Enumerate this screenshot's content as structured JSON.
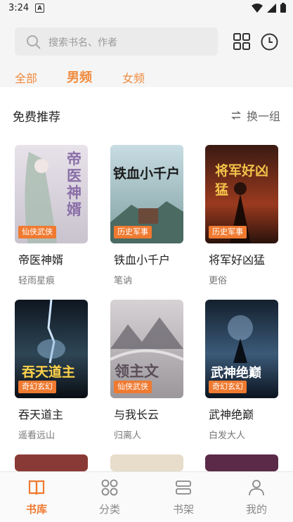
{
  "status_bar": {
    "time": "3:24",
    "notif_letter": "A"
  },
  "search": {
    "placeholder": "搜索书名、作者"
  },
  "tabs": [
    {
      "label": "全部",
      "active": false
    },
    {
      "label": "男频",
      "active": true
    },
    {
      "label": "女频",
      "active": false
    }
  ],
  "section": {
    "title": "免费推荐",
    "refresh_label": "换一组"
  },
  "books": [
    {
      "name": "帝医神婿",
      "author": "轻雨星痕",
      "tag": "仙侠武侠",
      "cover_text": "帝医神婿",
      "cover_color": "#d9d3dc"
    },
    {
      "name": "铁血小千户",
      "author": "笔讷",
      "tag": "历史军事",
      "cover_text": "铁血小千户",
      "cover_color": "#8fb0bd"
    },
    {
      "name": "将军好凶猛",
      "author": "更俗",
      "tag": "历史军事",
      "cover_text": "将军好凶猛",
      "cover_color": "#6a2a1a"
    },
    {
      "name": "吞天道主",
      "author": "遥看远山",
      "tag": "奇幻玄幻",
      "cover_text": "吞天道主",
      "cover_color": "#1f2b36"
    },
    {
      "name": "与我长云",
      "author": "归离人",
      "tag": "仙侠武侠",
      "cover_text": "领主文",
      "cover_color": "#a6a0a4"
    },
    {
      "name": "武神绝巅",
      "author": "白发大人",
      "tag": "奇幻玄幻",
      "cover_text": "武神绝巅",
      "cover_color": "#24364a"
    }
  ],
  "bottom_nav": [
    {
      "label": "书库",
      "icon": "book-icon",
      "active": true
    },
    {
      "label": "分类",
      "icon": "category-icon",
      "active": false
    },
    {
      "label": "书架",
      "icon": "bookshelf-icon",
      "active": false
    },
    {
      "label": "我的",
      "icon": "profile-icon",
      "active": false
    }
  ],
  "colors": {
    "accent": "#ef7a30",
    "topbar_bg": "#f5f5f5"
  }
}
